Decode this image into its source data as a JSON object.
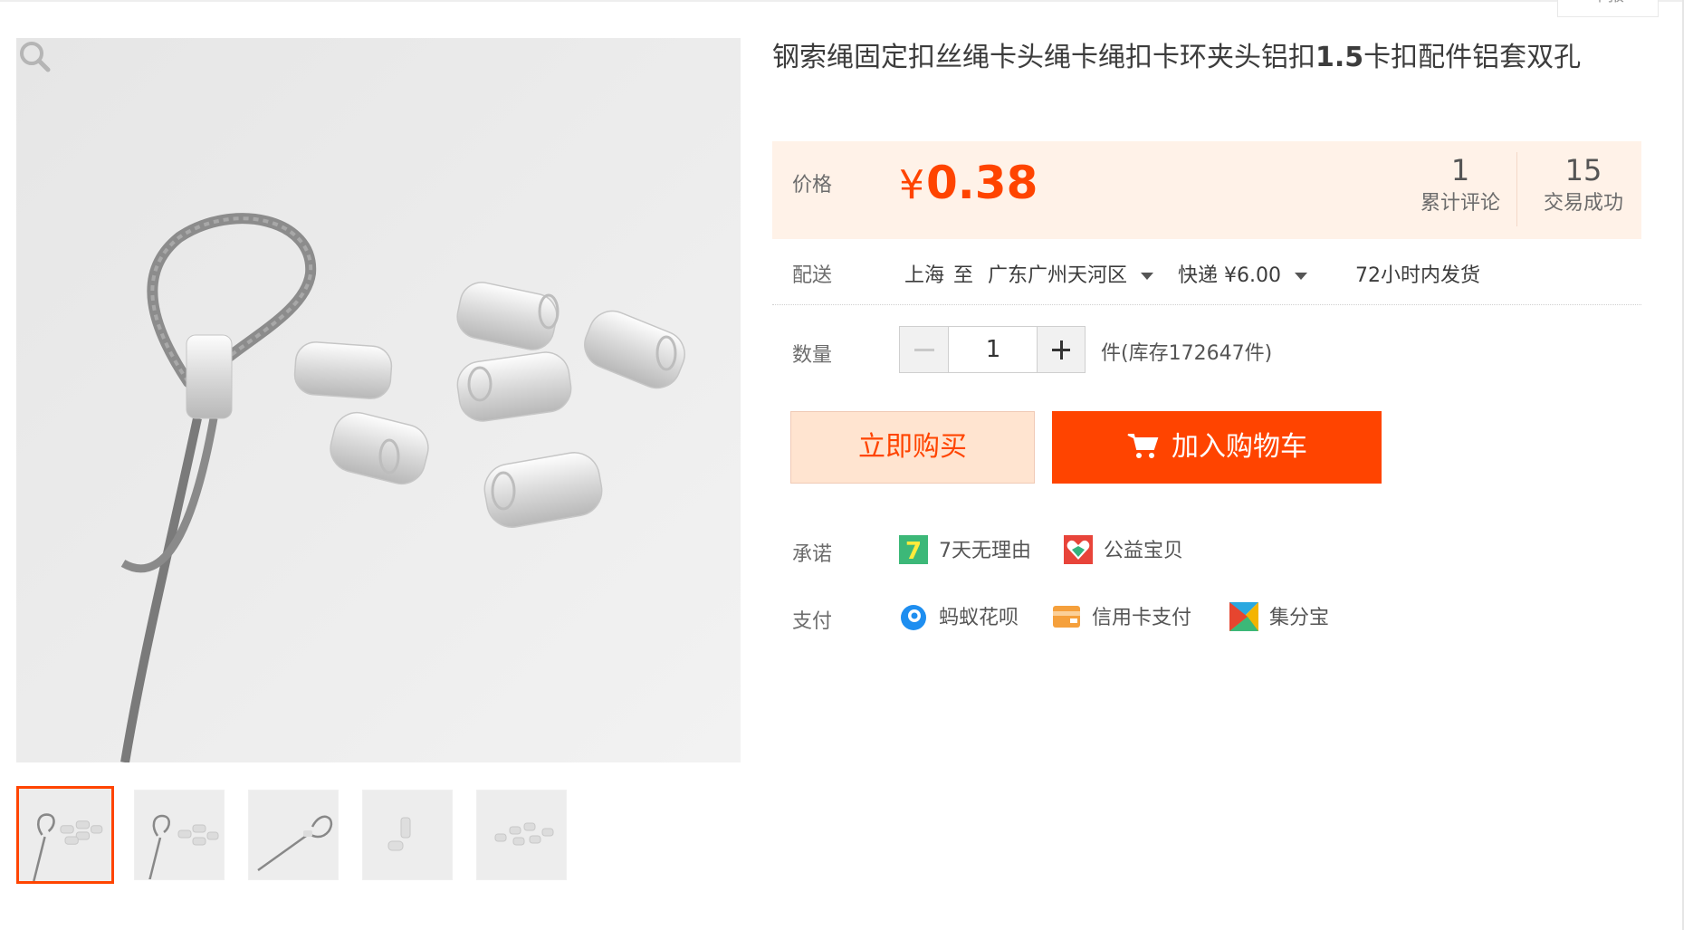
{
  "header": {
    "report_label": "举报"
  },
  "product": {
    "title_part1": "钢索绳固定扣丝绳卡头绳卡绳扣卡环夹头铝扣",
    "title_bold": "1.5",
    "title_part2": "卡扣配件铝套双孔"
  },
  "price": {
    "label": "价格",
    "currency": "¥",
    "value": "0.38",
    "reviews_count": "1",
    "reviews_label": "累计评论",
    "sales_count": "15",
    "sales_label": "交易成功"
  },
  "shipping": {
    "label": "配送",
    "from": "上海",
    "to_word": "至",
    "destination": "广东广州天河区",
    "method": "快递 ¥6.00",
    "dispatch": "72小时内发货"
  },
  "quantity": {
    "label": "数量",
    "value": "1",
    "stock_text": "件(库存172647件)"
  },
  "actions": {
    "buy_now": "立即购买",
    "add_to_cart": "加入购物车"
  },
  "promise": {
    "label": "承诺",
    "items": [
      {
        "icon": "seven-day-return-icon",
        "text": "7天无理由"
      },
      {
        "icon": "charity-heart-icon",
        "text": "公益宝贝"
      }
    ]
  },
  "payment": {
    "label": "支付",
    "items": [
      {
        "icon": "huabei-icon",
        "text": "蚂蚁花呗"
      },
      {
        "icon": "credit-card-icon",
        "text": "信用卡支付"
      },
      {
        "icon": "jifenbao-icon",
        "text": "集分宝"
      }
    ]
  },
  "colors": {
    "accent": "#ff4400",
    "price_bg": "#fff2e8",
    "buy_bg": "#ffe4d0"
  }
}
